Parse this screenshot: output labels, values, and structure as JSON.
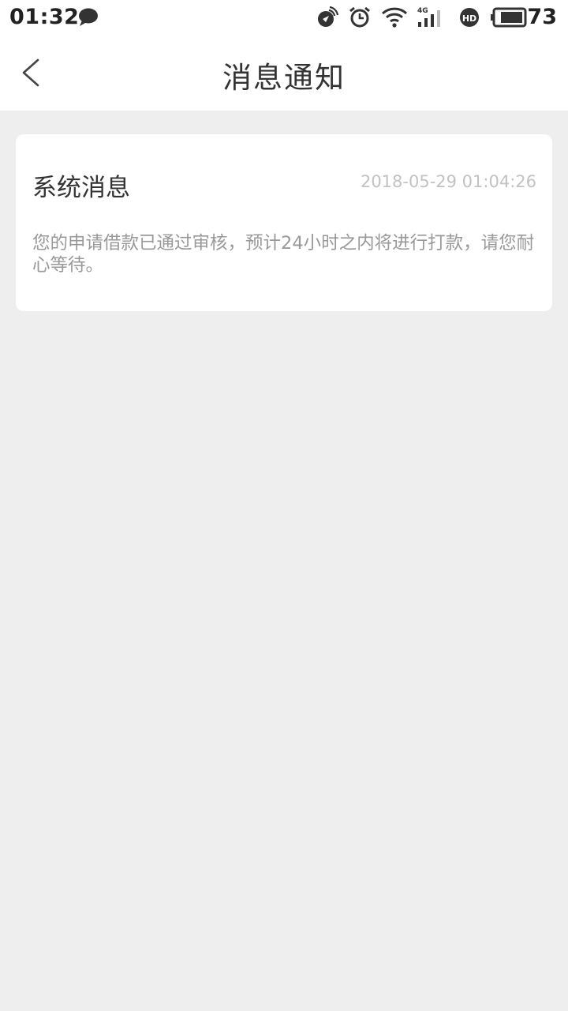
{
  "status_bar": {
    "time": "01:32",
    "battery_level": "73",
    "network": "4G",
    "icons": [
      "chat-bubble-icon",
      "location-icon",
      "alarm-icon",
      "wifi-icon",
      "signal-icon",
      "hd-icon",
      "battery-icon"
    ]
  },
  "header": {
    "title": "消息通知",
    "back_icon": "chevron-left-icon"
  },
  "messages": [
    {
      "title": "系统消息",
      "timestamp": "2018-05-29 01:04:26",
      "body": "您的申请借款已通过审核，预计24小时之内将进行打款，请您耐心等待。"
    }
  ],
  "colors": {
    "background": "#eeeeee",
    "card": "#ffffff",
    "title_text": "#333333",
    "timestamp_text": "#c2c2c2",
    "body_text": "#999999"
  }
}
